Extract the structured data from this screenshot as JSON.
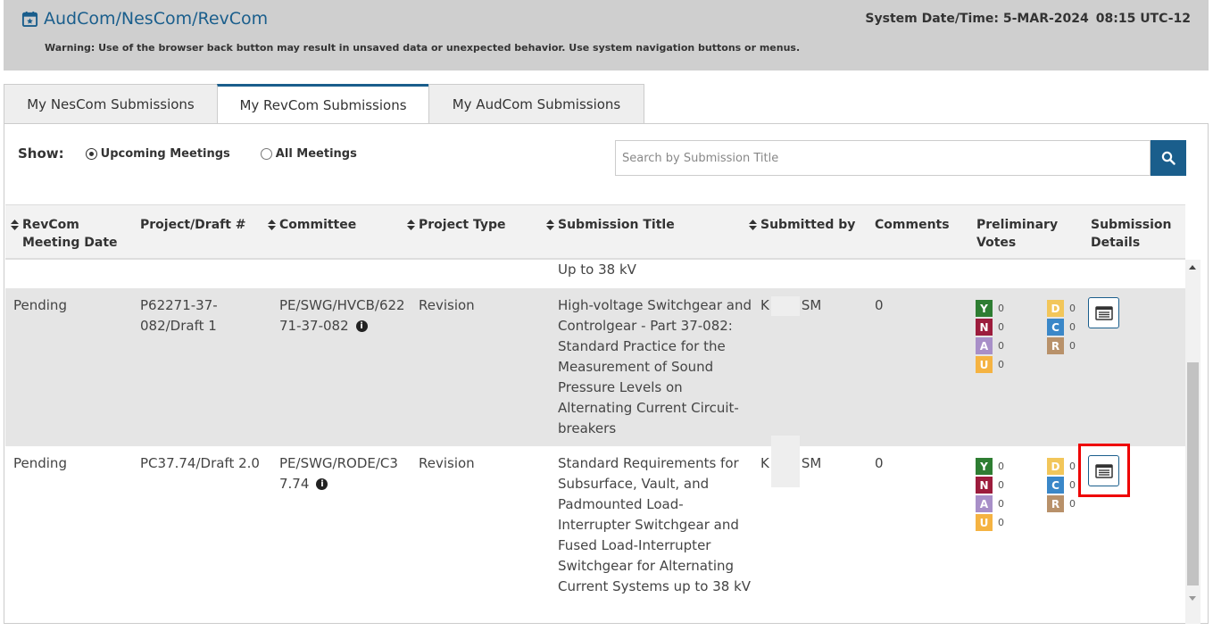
{
  "header": {
    "title": "AudCom/NesCom/RevCom",
    "system_date_label": "System Date/Time: 5-MAR-2024",
    "system_time": "08:15 UTC-12",
    "warning": "Warning: Use of the browser back button may result in unsaved data or unexpected behavior. Use system navigation buttons or menus."
  },
  "tabs": [
    {
      "label": "My NesCom Submissions"
    },
    {
      "label": "My RevCom Submissions",
      "active": true
    },
    {
      "label": "My AudCom Submissions"
    }
  ],
  "filters": {
    "show_label": "Show:",
    "options": [
      "Upcoming Meetings",
      "All Meetings"
    ],
    "selected": "Upcoming Meetings"
  },
  "search": {
    "placeholder": "Search by Submission Title"
  },
  "table": {
    "columns": [
      "RevCom Meeting Date",
      "Project/Draft #",
      "Committee",
      "Project Type",
      "Submission Title",
      "Submitted by",
      "Comments",
      "Preliminary Votes",
      "Submission Details"
    ],
    "partial_row_title": "Up to 38 kV",
    "rows": [
      {
        "date": "Pending",
        "project": "P62271-37-082/Draft 1",
        "committee": "PE/SWG/HVCB/62271-37-082",
        "type": "Revision",
        "title": "High-voltage Switchgear and Controlgear - Part 37-082: Standard Practice for the Measurement of Sound Pressure Levels on Alternating Current Circuit-breakers",
        "submitted_prefix": "K",
        "submitted_suffix": "SM",
        "comments": "0",
        "votes": {
          "Y": "0",
          "N": "0",
          "A": "0",
          "U": "0",
          "D": "0",
          "C": "0",
          "R": "0"
        }
      },
      {
        "date": "Pending",
        "project": "PC37.74/Draft 2.0",
        "committee": "PE/SWG/RODE/C37.74",
        "type": "Revision",
        "title": "Standard Requirements for Subsurface, Vault, and Padmounted Load-Interrupter Switchgear and Fused Load-Interrupter Switchgear for Alternating Current Systems up to 38 kV",
        "submitted_prefix": "K",
        "submitted_suffix": "SM",
        "comments": "0",
        "votes": {
          "Y": "0",
          "N": "0",
          "A": "0",
          "U": "0",
          "D": "0",
          "C": "0",
          "R": "0"
        }
      }
    ]
  },
  "vote_labels": {
    "Y": "Y",
    "N": "N",
    "A": "A",
    "U": "U",
    "D": "D",
    "C": "C",
    "R": "R"
  },
  "vote_colors": {
    "Y": "#2e7d32",
    "N": "#9c1c3c",
    "A": "#a88fc8",
    "U": "#f5b342",
    "D": "#f2c65a",
    "C": "#3a87c8",
    "R": "#b8916a"
  },
  "accent_color": "#1a5e8c",
  "icons": {
    "title_icon": "calendar-icon",
    "search_button": "search-icon",
    "details_button": "details-list-icon",
    "info": "info-icon"
  }
}
